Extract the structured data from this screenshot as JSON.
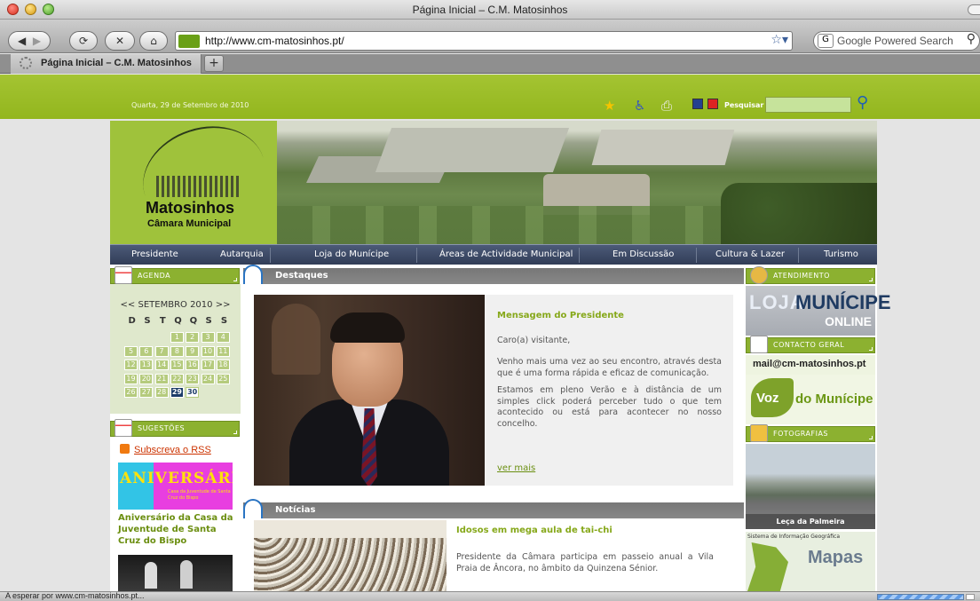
{
  "window": {
    "title": "Página Inicial – C.M. Matosinhos"
  },
  "toolbar": {
    "back_icon": "back-arrow",
    "forward_icon": "forward-arrow",
    "reload_icon": "reload",
    "stop_icon": "stop",
    "home_icon": "home",
    "url": "http://www.cm-matosinhos.pt/",
    "search_placeholder": "Google Powered Search"
  },
  "tabs": [
    {
      "label": "Página Inicial – C.M. Matosinhos"
    }
  ],
  "newtab_label": "+",
  "page": {
    "date": "Quarta, 29 de Setembro de 2010",
    "search_label": "Pesquisar",
    "logo": {
      "name": "Matosinhos",
      "subtitle": "Câmara Municipal"
    },
    "nav": [
      "Presidente",
      "Autarquia",
      "Loja do Munícipe",
      "Áreas de Actividade Municipal",
      "Em Discussão",
      "Cultura & Lazer",
      "Turismo"
    ],
    "agenda": {
      "title": "AGENDA",
      "month": "<< SETEMBRO 2010 >>",
      "daynames": [
        "D",
        "S",
        "T",
        "Q",
        "Q",
        "S",
        "S"
      ],
      "days": [
        "1",
        "2",
        "3",
        "4",
        "5",
        "6",
        "7",
        "8",
        "9",
        "10",
        "11",
        "12",
        "13",
        "14",
        "15",
        "16",
        "17",
        "18",
        "19",
        "20",
        "21",
        "22",
        "23",
        "24",
        "25",
        "26",
        "27",
        "28",
        "29",
        "30"
      ],
      "today": "29",
      "selected": "30"
    },
    "sugestoes": {
      "title": "SUGESTÕES",
      "rss": "Subscreva o RSS",
      "banner_big": "ANIVERSÁRIO",
      "banner_small": "Casa da Juventude de Santa Cruz do Bispo",
      "item_title": "Aniversário da Casa da Juventude de Santa Cruz do Bispo"
    },
    "destaques": {
      "title": "Destaques",
      "heading": "Mensagem do Presidente",
      "p1": "Caro(a) visitante,",
      "p2": "Venho mais uma vez ao seu encontro, através desta que é uma forma rápida e eficaz de comunicação.",
      "p3": "Estamos em pleno Verão e à distância de um simples click poderá perceber tudo o que tem acontecido ou está para acontecer no nosso concelho.",
      "more": "ver mais"
    },
    "noticias": {
      "title": "Notícias",
      "heading": "Idosos em mega aula de tai-chi",
      "text": "Presidente da Câmara participa em passeio anual a Vila Praia de Âncora, no âmbito da Quinzena Sénior."
    },
    "right": {
      "atendimento": "ATENDIMENTO",
      "loja_a": "LOJA",
      "loja_b": "MUNÍCIPE",
      "loja_c": "ONLINE",
      "contacto": "CONTACTO GERAL",
      "email": "mail@cm-matosinhos.pt",
      "voz_a": "Voz",
      "voz_b": "do Munícipe",
      "fotografias": "FOTOGRAFIAS",
      "foto_caption": "Leça da Palmeira",
      "sig": "Sistema de Informação Geográfica",
      "mapas": "Mapas"
    }
  },
  "status": {
    "text": "A esperar por www.cm-matosinhos.pt..."
  },
  "colors": {
    "brand_green": "#9ab92a",
    "nav_blue": "#3a4766",
    "link_green": "#86a81a"
  }
}
